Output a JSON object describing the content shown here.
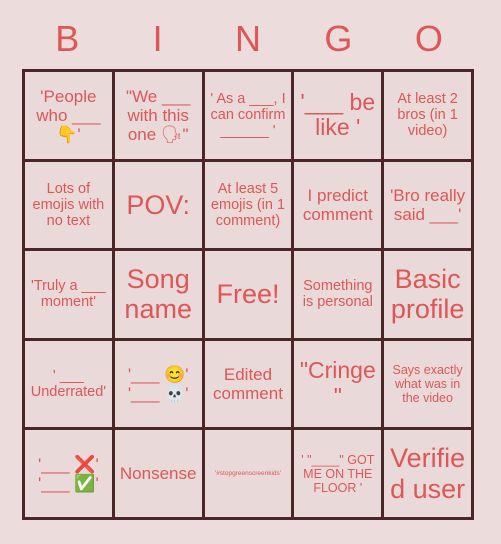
{
  "card": {
    "title": "BINGO",
    "header_letters": [
      "B",
      "I",
      "N",
      "G",
      "O"
    ],
    "colors": {
      "background": "#ecdcdc",
      "cell_background": "#ead9d9",
      "grid_line": "#4a2626",
      "text": "#dd5757"
    },
    "grid_size": "5x5",
    "cells": [
      {
        "id": "b1",
        "text": "'People who ___ 👇'",
        "size": "md"
      },
      {
        "id": "i1",
        "text": "\"We ___ with this one 🗣\"",
        "size": "md"
      },
      {
        "id": "n1",
        "text": "' As a ___, I can confirm ______ '",
        "size": "sm"
      },
      {
        "id": "g1",
        "text": "'___ be like '",
        "size": "lg"
      },
      {
        "id": "o1",
        "text": "At least 2 bros (in 1 video)",
        "size": "sm"
      },
      {
        "id": "b2",
        "text": "Lots of emojis with no text",
        "size": "sm"
      },
      {
        "id": "i2",
        "text": "POV:",
        "size": "xl"
      },
      {
        "id": "n2",
        "text": "At least 5 emojis (in 1 comment)",
        "size": "sm"
      },
      {
        "id": "g2",
        "text": "I predict comment",
        "size": "md"
      },
      {
        "id": "o2",
        "text": "'Bro really said ___'",
        "size": "md"
      },
      {
        "id": "b3",
        "text": "'Truly a ___ moment'",
        "size": "sm"
      },
      {
        "id": "i3",
        "text": "Song name",
        "size": "xl"
      },
      {
        "id": "n3",
        "text": "Free!",
        "size": "xl"
      },
      {
        "id": "g3",
        "text": "Something is personal",
        "size": "sm"
      },
      {
        "id": "o3",
        "text": "Basic profile",
        "size": "xl"
      },
      {
        "id": "b4",
        "text": "' ___ Underrated'",
        "size": "sm"
      },
      {
        "id": "i4",
        "text": "'___ 😊' '___ 💀'",
        "size": "md"
      },
      {
        "id": "n4",
        "text": "Edited comment",
        "size": "md"
      },
      {
        "id": "g4",
        "text": "\"Cringe\"",
        "size": "lg"
      },
      {
        "id": "o4",
        "text": "Says exactly what was in the video",
        "size": "xs"
      },
      {
        "id": "b5",
        "text": "'___ ❌' '___ ✅'",
        "size": "md"
      },
      {
        "id": "i5",
        "text": "Nonsense",
        "size": "md"
      },
      {
        "id": "n5",
        "text": "'#stopgreenscreenkids'",
        "size": "tiny"
      },
      {
        "id": "g5",
        "text": "' \"____\" GOT ME ON THE FLOOR '",
        "size": "xs"
      },
      {
        "id": "o5",
        "text": "Verified user",
        "size": "xl"
      }
    ]
  }
}
